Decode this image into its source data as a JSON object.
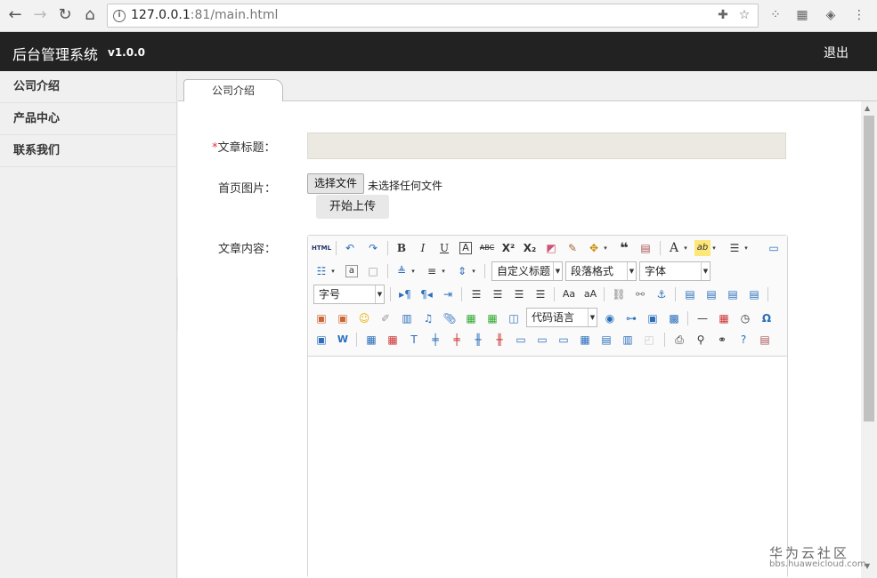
{
  "browser": {
    "url_host": "127.0.0.1",
    "url_rest": ":81/main.html"
  },
  "header": {
    "title": "后台管理系统",
    "version": "v1.0.0",
    "logout": "退出"
  },
  "sidebar": {
    "items": [
      {
        "label": "公司介绍"
      },
      {
        "label": "产品中心"
      },
      {
        "label": "联系我们"
      }
    ]
  },
  "tabs": [
    {
      "label": "公司介绍"
    }
  ],
  "form": {
    "title_required_mark": "*",
    "title_label": "文章标题：",
    "title_value": "",
    "image_label": "首页图片：",
    "file_button": "选择文件",
    "file_status": "未选择任何文件",
    "upload_button": "开始上传",
    "content_label": "文章内容："
  },
  "editor": {
    "html_label": "HTML",
    "selects": {
      "custom_heading": "自定义标题",
      "paragraph_format": "段落格式",
      "font_family": "字体",
      "font_size": "字号",
      "code_language": "代码语言"
    }
  },
  "watermark": {
    "cn": "华为云社区",
    "en": "bbs.huaweicloud.com"
  }
}
